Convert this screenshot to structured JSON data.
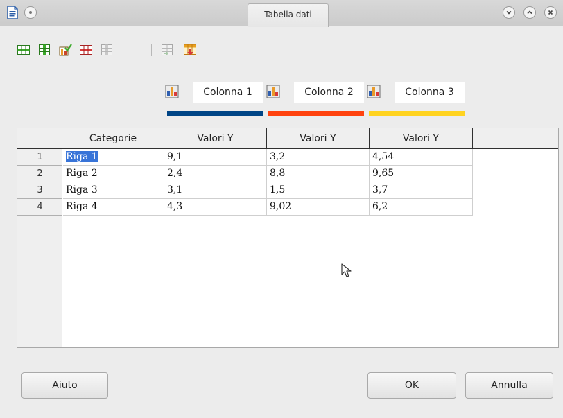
{
  "window": {
    "title": "Tabella dati"
  },
  "toolbar": {
    "icons": [
      "insert-row-icon",
      "insert-series-icon",
      "insert-text-column-icon",
      "delete-row-icon",
      "delete-series-icon",
      "move-series-right-icon",
      "move-row-down-icon"
    ]
  },
  "series": [
    {
      "name": "Colonna 1",
      "color": "#004586"
    },
    {
      "name": "Colonna 2",
      "color": "#ff420e"
    },
    {
      "name": "Colonna 3",
      "color": "#ffd320"
    }
  ],
  "table": {
    "headers": [
      "Categorie",
      "Valori Y",
      "Valori Y",
      "Valori Y"
    ],
    "rows": [
      {
        "num": "1",
        "cells": [
          "Riga 1",
          "9,1",
          "3,2",
          "4,54"
        ]
      },
      {
        "num": "2",
        "cells": [
          "Riga 2",
          "2,4",
          "8,8",
          "9,65"
        ]
      },
      {
        "num": "3",
        "cells": [
          "Riga 3",
          "3,1",
          "1,5",
          "3,7"
        ]
      },
      {
        "num": "4",
        "cells": [
          "Riga 4",
          "4,3",
          "9,02",
          "6,2"
        ]
      }
    ]
  },
  "buttons": {
    "help": "Aiuto",
    "ok": "OK",
    "cancel": "Annulla"
  },
  "colors": {
    "selection": "#3874d8"
  }
}
